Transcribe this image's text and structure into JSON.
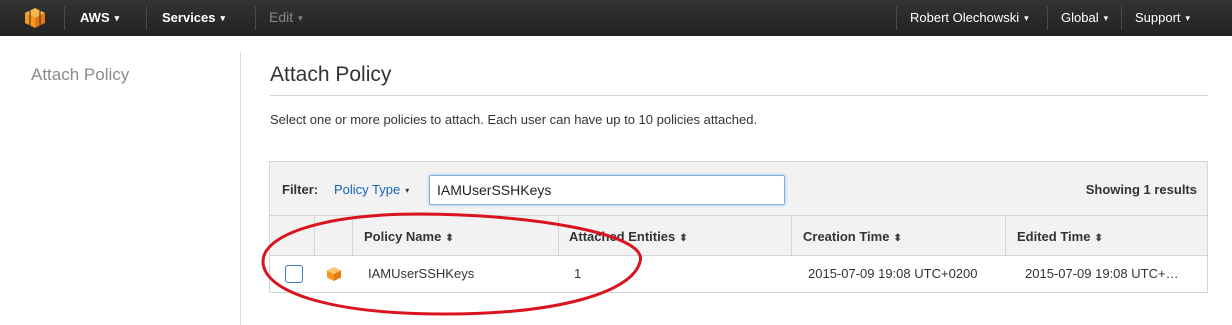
{
  "topnav": {
    "aws_label": "AWS",
    "services_label": "Services",
    "edit_label": "Edit",
    "user_label": "Robert Olechowski",
    "region_label": "Global",
    "support_label": "Support",
    "caret": "▾"
  },
  "sidebar": {
    "title": "Attach Policy"
  },
  "main": {
    "title": "Attach Policy",
    "description": "Select one or more policies to attach. Each user can have up to 10 policies attached."
  },
  "filter": {
    "label": "Filter:",
    "policy_type_label": "Policy Type",
    "search_value": "IAMUserSSHKeys",
    "results_text": "Showing 1 results"
  },
  "table": {
    "sort_icon": "⬍",
    "columns": [
      "Policy Name",
      "Attached Entities",
      "Creation Time",
      "Edited Time"
    ],
    "rows": [
      {
        "policy_name": "IAMUserSSHKeys",
        "attached_entities": "1",
        "creation_time": "2015-07-09 19:08 UTC+0200",
        "edited_time": "2015-07-09 19:08 UTC+…",
        "checked": false
      }
    ]
  },
  "colors": {
    "nav_bg": "#2b2b2b",
    "link_blue": "#1166bb",
    "aws_orange": "#f7981d",
    "annotation_red": "#d9141e"
  }
}
